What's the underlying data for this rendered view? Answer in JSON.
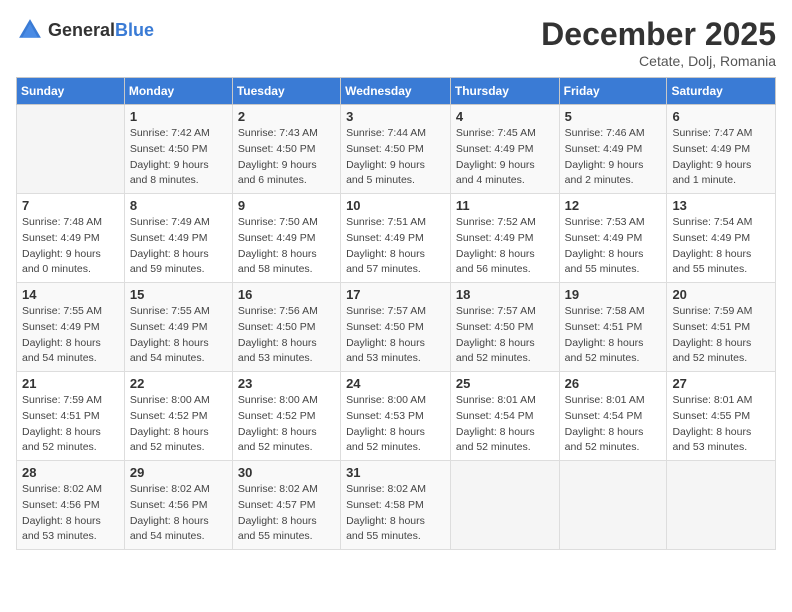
{
  "header": {
    "logo_general": "General",
    "logo_blue": "Blue",
    "month_year": "December 2025",
    "location": "Cetate, Dolj, Romania"
  },
  "days_of_week": [
    "Sunday",
    "Monday",
    "Tuesday",
    "Wednesday",
    "Thursday",
    "Friday",
    "Saturday"
  ],
  "weeks": [
    [
      {
        "num": "",
        "sunrise": "",
        "sunset": "",
        "daylight": ""
      },
      {
        "num": "1",
        "sunrise": "Sunrise: 7:42 AM",
        "sunset": "Sunset: 4:50 PM",
        "daylight": "Daylight: 9 hours and 8 minutes."
      },
      {
        "num": "2",
        "sunrise": "Sunrise: 7:43 AM",
        "sunset": "Sunset: 4:50 PM",
        "daylight": "Daylight: 9 hours and 6 minutes."
      },
      {
        "num": "3",
        "sunrise": "Sunrise: 7:44 AM",
        "sunset": "Sunset: 4:50 PM",
        "daylight": "Daylight: 9 hours and 5 minutes."
      },
      {
        "num": "4",
        "sunrise": "Sunrise: 7:45 AM",
        "sunset": "Sunset: 4:49 PM",
        "daylight": "Daylight: 9 hours and 4 minutes."
      },
      {
        "num": "5",
        "sunrise": "Sunrise: 7:46 AM",
        "sunset": "Sunset: 4:49 PM",
        "daylight": "Daylight: 9 hours and 2 minutes."
      },
      {
        "num": "6",
        "sunrise": "Sunrise: 7:47 AM",
        "sunset": "Sunset: 4:49 PM",
        "daylight": "Daylight: 9 hours and 1 minute."
      }
    ],
    [
      {
        "num": "7",
        "sunrise": "Sunrise: 7:48 AM",
        "sunset": "Sunset: 4:49 PM",
        "daylight": "Daylight: 9 hours and 0 minutes."
      },
      {
        "num": "8",
        "sunrise": "Sunrise: 7:49 AM",
        "sunset": "Sunset: 4:49 PM",
        "daylight": "Daylight: 8 hours and 59 minutes."
      },
      {
        "num": "9",
        "sunrise": "Sunrise: 7:50 AM",
        "sunset": "Sunset: 4:49 PM",
        "daylight": "Daylight: 8 hours and 58 minutes."
      },
      {
        "num": "10",
        "sunrise": "Sunrise: 7:51 AM",
        "sunset": "Sunset: 4:49 PM",
        "daylight": "Daylight: 8 hours and 57 minutes."
      },
      {
        "num": "11",
        "sunrise": "Sunrise: 7:52 AM",
        "sunset": "Sunset: 4:49 PM",
        "daylight": "Daylight: 8 hours and 56 minutes."
      },
      {
        "num": "12",
        "sunrise": "Sunrise: 7:53 AM",
        "sunset": "Sunset: 4:49 PM",
        "daylight": "Daylight: 8 hours and 55 minutes."
      },
      {
        "num": "13",
        "sunrise": "Sunrise: 7:54 AM",
        "sunset": "Sunset: 4:49 PM",
        "daylight": "Daylight: 8 hours and 55 minutes."
      }
    ],
    [
      {
        "num": "14",
        "sunrise": "Sunrise: 7:55 AM",
        "sunset": "Sunset: 4:49 PM",
        "daylight": "Daylight: 8 hours and 54 minutes."
      },
      {
        "num": "15",
        "sunrise": "Sunrise: 7:55 AM",
        "sunset": "Sunset: 4:49 PM",
        "daylight": "Daylight: 8 hours and 54 minutes."
      },
      {
        "num": "16",
        "sunrise": "Sunrise: 7:56 AM",
        "sunset": "Sunset: 4:50 PM",
        "daylight": "Daylight: 8 hours and 53 minutes."
      },
      {
        "num": "17",
        "sunrise": "Sunrise: 7:57 AM",
        "sunset": "Sunset: 4:50 PM",
        "daylight": "Daylight: 8 hours and 53 minutes."
      },
      {
        "num": "18",
        "sunrise": "Sunrise: 7:57 AM",
        "sunset": "Sunset: 4:50 PM",
        "daylight": "Daylight: 8 hours and 52 minutes."
      },
      {
        "num": "19",
        "sunrise": "Sunrise: 7:58 AM",
        "sunset": "Sunset: 4:51 PM",
        "daylight": "Daylight: 8 hours and 52 minutes."
      },
      {
        "num": "20",
        "sunrise": "Sunrise: 7:59 AM",
        "sunset": "Sunset: 4:51 PM",
        "daylight": "Daylight: 8 hours and 52 minutes."
      }
    ],
    [
      {
        "num": "21",
        "sunrise": "Sunrise: 7:59 AM",
        "sunset": "Sunset: 4:51 PM",
        "daylight": "Daylight: 8 hours and 52 minutes."
      },
      {
        "num": "22",
        "sunrise": "Sunrise: 8:00 AM",
        "sunset": "Sunset: 4:52 PM",
        "daylight": "Daylight: 8 hours and 52 minutes."
      },
      {
        "num": "23",
        "sunrise": "Sunrise: 8:00 AM",
        "sunset": "Sunset: 4:52 PM",
        "daylight": "Daylight: 8 hours and 52 minutes."
      },
      {
        "num": "24",
        "sunrise": "Sunrise: 8:00 AM",
        "sunset": "Sunset: 4:53 PM",
        "daylight": "Daylight: 8 hours and 52 minutes."
      },
      {
        "num": "25",
        "sunrise": "Sunrise: 8:01 AM",
        "sunset": "Sunset: 4:54 PM",
        "daylight": "Daylight: 8 hours and 52 minutes."
      },
      {
        "num": "26",
        "sunrise": "Sunrise: 8:01 AM",
        "sunset": "Sunset: 4:54 PM",
        "daylight": "Daylight: 8 hours and 52 minutes."
      },
      {
        "num": "27",
        "sunrise": "Sunrise: 8:01 AM",
        "sunset": "Sunset: 4:55 PM",
        "daylight": "Daylight: 8 hours and 53 minutes."
      }
    ],
    [
      {
        "num": "28",
        "sunrise": "Sunrise: 8:02 AM",
        "sunset": "Sunset: 4:56 PM",
        "daylight": "Daylight: 8 hours and 53 minutes."
      },
      {
        "num": "29",
        "sunrise": "Sunrise: 8:02 AM",
        "sunset": "Sunset: 4:56 PM",
        "daylight": "Daylight: 8 hours and 54 minutes."
      },
      {
        "num": "30",
        "sunrise": "Sunrise: 8:02 AM",
        "sunset": "Sunset: 4:57 PM",
        "daylight": "Daylight: 8 hours and 55 minutes."
      },
      {
        "num": "31",
        "sunrise": "Sunrise: 8:02 AM",
        "sunset": "Sunset: 4:58 PM",
        "daylight": "Daylight: 8 hours and 55 minutes."
      },
      {
        "num": "",
        "sunrise": "",
        "sunset": "",
        "daylight": ""
      },
      {
        "num": "",
        "sunrise": "",
        "sunset": "",
        "daylight": ""
      },
      {
        "num": "",
        "sunrise": "",
        "sunset": "",
        "daylight": ""
      }
    ]
  ]
}
